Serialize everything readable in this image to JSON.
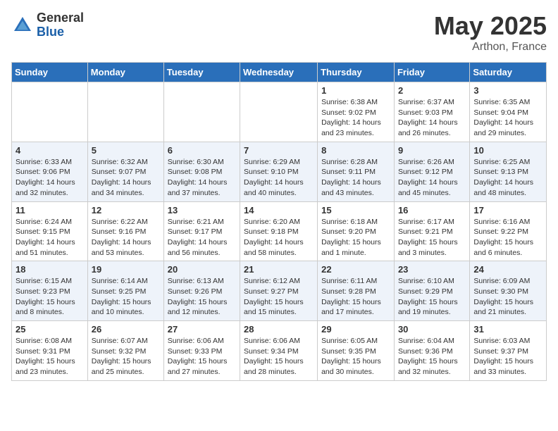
{
  "header": {
    "logo_general": "General",
    "logo_blue": "Blue",
    "title_month": "May 2025",
    "title_location": "Arthon, France"
  },
  "weekdays": [
    "Sunday",
    "Monday",
    "Tuesday",
    "Wednesday",
    "Thursday",
    "Friday",
    "Saturday"
  ],
  "weeks": [
    [
      {
        "day": "",
        "info": ""
      },
      {
        "day": "",
        "info": ""
      },
      {
        "day": "",
        "info": ""
      },
      {
        "day": "",
        "info": ""
      },
      {
        "day": "1",
        "info": "Sunrise: 6:38 AM\nSunset: 9:02 PM\nDaylight: 14 hours\nand 23 minutes."
      },
      {
        "day": "2",
        "info": "Sunrise: 6:37 AM\nSunset: 9:03 PM\nDaylight: 14 hours\nand 26 minutes."
      },
      {
        "day": "3",
        "info": "Sunrise: 6:35 AM\nSunset: 9:04 PM\nDaylight: 14 hours\nand 29 minutes."
      }
    ],
    [
      {
        "day": "4",
        "info": "Sunrise: 6:33 AM\nSunset: 9:06 PM\nDaylight: 14 hours\nand 32 minutes."
      },
      {
        "day": "5",
        "info": "Sunrise: 6:32 AM\nSunset: 9:07 PM\nDaylight: 14 hours\nand 34 minutes."
      },
      {
        "day": "6",
        "info": "Sunrise: 6:30 AM\nSunset: 9:08 PM\nDaylight: 14 hours\nand 37 minutes."
      },
      {
        "day": "7",
        "info": "Sunrise: 6:29 AM\nSunset: 9:10 PM\nDaylight: 14 hours\nand 40 minutes."
      },
      {
        "day": "8",
        "info": "Sunrise: 6:28 AM\nSunset: 9:11 PM\nDaylight: 14 hours\nand 43 minutes."
      },
      {
        "day": "9",
        "info": "Sunrise: 6:26 AM\nSunset: 9:12 PM\nDaylight: 14 hours\nand 45 minutes."
      },
      {
        "day": "10",
        "info": "Sunrise: 6:25 AM\nSunset: 9:13 PM\nDaylight: 14 hours\nand 48 minutes."
      }
    ],
    [
      {
        "day": "11",
        "info": "Sunrise: 6:24 AM\nSunset: 9:15 PM\nDaylight: 14 hours\nand 51 minutes."
      },
      {
        "day": "12",
        "info": "Sunrise: 6:22 AM\nSunset: 9:16 PM\nDaylight: 14 hours\nand 53 minutes."
      },
      {
        "day": "13",
        "info": "Sunrise: 6:21 AM\nSunset: 9:17 PM\nDaylight: 14 hours\nand 56 minutes."
      },
      {
        "day": "14",
        "info": "Sunrise: 6:20 AM\nSunset: 9:18 PM\nDaylight: 14 hours\nand 58 minutes."
      },
      {
        "day": "15",
        "info": "Sunrise: 6:18 AM\nSunset: 9:20 PM\nDaylight: 15 hours\nand 1 minute."
      },
      {
        "day": "16",
        "info": "Sunrise: 6:17 AM\nSunset: 9:21 PM\nDaylight: 15 hours\nand 3 minutes."
      },
      {
        "day": "17",
        "info": "Sunrise: 6:16 AM\nSunset: 9:22 PM\nDaylight: 15 hours\nand 6 minutes."
      }
    ],
    [
      {
        "day": "18",
        "info": "Sunrise: 6:15 AM\nSunset: 9:23 PM\nDaylight: 15 hours\nand 8 minutes."
      },
      {
        "day": "19",
        "info": "Sunrise: 6:14 AM\nSunset: 9:25 PM\nDaylight: 15 hours\nand 10 minutes."
      },
      {
        "day": "20",
        "info": "Sunrise: 6:13 AM\nSunset: 9:26 PM\nDaylight: 15 hours\nand 12 minutes."
      },
      {
        "day": "21",
        "info": "Sunrise: 6:12 AM\nSunset: 9:27 PM\nDaylight: 15 hours\nand 15 minutes."
      },
      {
        "day": "22",
        "info": "Sunrise: 6:11 AM\nSunset: 9:28 PM\nDaylight: 15 hours\nand 17 minutes."
      },
      {
        "day": "23",
        "info": "Sunrise: 6:10 AM\nSunset: 9:29 PM\nDaylight: 15 hours\nand 19 minutes."
      },
      {
        "day": "24",
        "info": "Sunrise: 6:09 AM\nSunset: 9:30 PM\nDaylight: 15 hours\nand 21 minutes."
      }
    ],
    [
      {
        "day": "25",
        "info": "Sunrise: 6:08 AM\nSunset: 9:31 PM\nDaylight: 15 hours\nand 23 minutes."
      },
      {
        "day": "26",
        "info": "Sunrise: 6:07 AM\nSunset: 9:32 PM\nDaylight: 15 hours\nand 25 minutes."
      },
      {
        "day": "27",
        "info": "Sunrise: 6:06 AM\nSunset: 9:33 PM\nDaylight: 15 hours\nand 27 minutes."
      },
      {
        "day": "28",
        "info": "Sunrise: 6:06 AM\nSunset: 9:34 PM\nDaylight: 15 hours\nand 28 minutes."
      },
      {
        "day": "29",
        "info": "Sunrise: 6:05 AM\nSunset: 9:35 PM\nDaylight: 15 hours\nand 30 minutes."
      },
      {
        "day": "30",
        "info": "Sunrise: 6:04 AM\nSunset: 9:36 PM\nDaylight: 15 hours\nand 32 minutes."
      },
      {
        "day": "31",
        "info": "Sunrise: 6:03 AM\nSunset: 9:37 PM\nDaylight: 15 hours\nand 33 minutes."
      }
    ]
  ]
}
